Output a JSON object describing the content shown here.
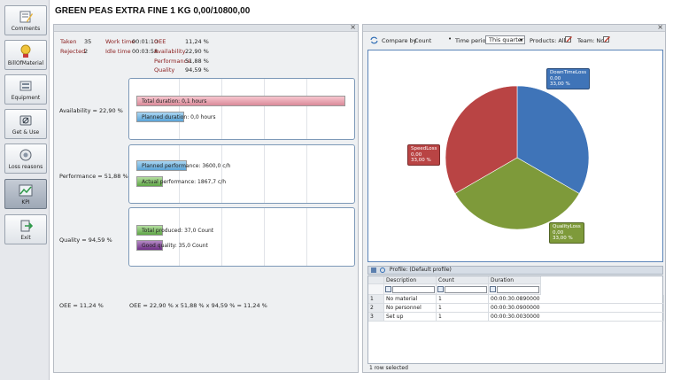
{
  "header": {
    "title": "GREEN PEAS EXTRA FINE 1 KG  0,00/10800,00"
  },
  "sidebar": {
    "items": [
      {
        "label": "Comments",
        "icon": "comments-icon"
      },
      {
        "label": "BillOfMaterial",
        "icon": "bill-of-material-icon"
      },
      {
        "label": "Equipment",
        "icon": "equipment-icon"
      },
      {
        "label": "Get & Use",
        "icon": "get-and-use-icon"
      },
      {
        "label": "Loss reasons",
        "icon": "loss-reasons-icon"
      },
      {
        "label": "KPI",
        "icon": "kpi-icon"
      },
      {
        "label": "Exit",
        "icon": "exit-icon"
      }
    ],
    "active": "KPI"
  },
  "summary": {
    "taken_label": "Taken",
    "taken_value": "35",
    "rejected_label": "Rejected",
    "rejected_value": "2",
    "work_time_label": "Work time",
    "work_time_value": "00:01:10",
    "idle_time_label": "Idle time",
    "idle_time_value": "00:03:58",
    "oee_label": "OEE",
    "oee_value": "11,24 %",
    "availability_label": "Availability",
    "availability_value": "22,90 %",
    "performance_label": "Performance",
    "performance_value": "51,88 %",
    "quality_label": "Quality",
    "quality_value": "94,59 %"
  },
  "kpi_rows": {
    "availability": {
      "label": "Availability = 22,90 %",
      "bars": [
        {
          "label": "Total duration: 0,1 hours",
          "fraction": 1.0
        },
        {
          "label": "Planned duration: 0,0 hours",
          "fraction": 0.23
        }
      ]
    },
    "performance": {
      "label": "Performance = 51,88 %",
      "bars": [
        {
          "label": "Planned performance: 3600,0 c/h",
          "fraction": 0.24
        },
        {
          "label": "Actual performance: 1867,7 c/h",
          "fraction": 0.12
        }
      ]
    },
    "quality": {
      "label": "Quality = 94,59 %",
      "bars": [
        {
          "label": "Total produced: 37,0 Count",
          "fraction": 0.12
        },
        {
          "label": "Good quality: 35,0 Count",
          "fraction": 0.11
        }
      ]
    }
  },
  "oee_footer": {
    "left": "OEE = 11,24 %",
    "formula": "OEE = 22,90 % x 51,88 % x 94,59 % = 11,24 %"
  },
  "toolbar": {
    "compare_by_label": "Compare by",
    "compare_by_value": "Count",
    "time_period_label": "Time period",
    "time_period_value": "This quarter",
    "products_label": "Products: All",
    "team_label": "Team: No"
  },
  "chart_data": {
    "type": "pie",
    "title": "",
    "slices": [
      {
        "name": "DownTimeLoss",
        "value_text": "0,00",
        "percent_text": "33,00 %",
        "value": 33.0,
        "color": "#3f74b8"
      },
      {
        "name": "QualityLoss",
        "value_text": "0,00",
        "percent_text": "33,00 %",
        "value": 33.0,
        "color": "#7e9a3a"
      },
      {
        "name": "SpeedLoss",
        "value_text": "0,00",
        "percent_text": "33,00 %",
        "value": 33.0,
        "color": "#b94444"
      }
    ]
  },
  "profile": {
    "title": "Profile: (Default profile)"
  },
  "loss_table": {
    "columns": [
      "Description",
      "Count",
      "Duration"
    ],
    "rows": [
      {
        "index": "1",
        "description": "No material",
        "count": "1",
        "duration": "00:00:30.0890000"
      },
      {
        "index": "2",
        "description": "No personnel",
        "count": "1",
        "duration": "00:00:30.0900000"
      },
      {
        "index": "3",
        "description": "Set up",
        "count": "1",
        "duration": "00:00:30.0030000"
      }
    ],
    "status": "1 row selected"
  },
  "colors": {
    "availability_total": "#e6a0ad",
    "availability_planned": "#6fb3de",
    "performance_planned": "#5aa6d2",
    "performance_actual": "#73b358",
    "quality_total": "#6dbb58",
    "quality_good": "#7a3a8f"
  }
}
